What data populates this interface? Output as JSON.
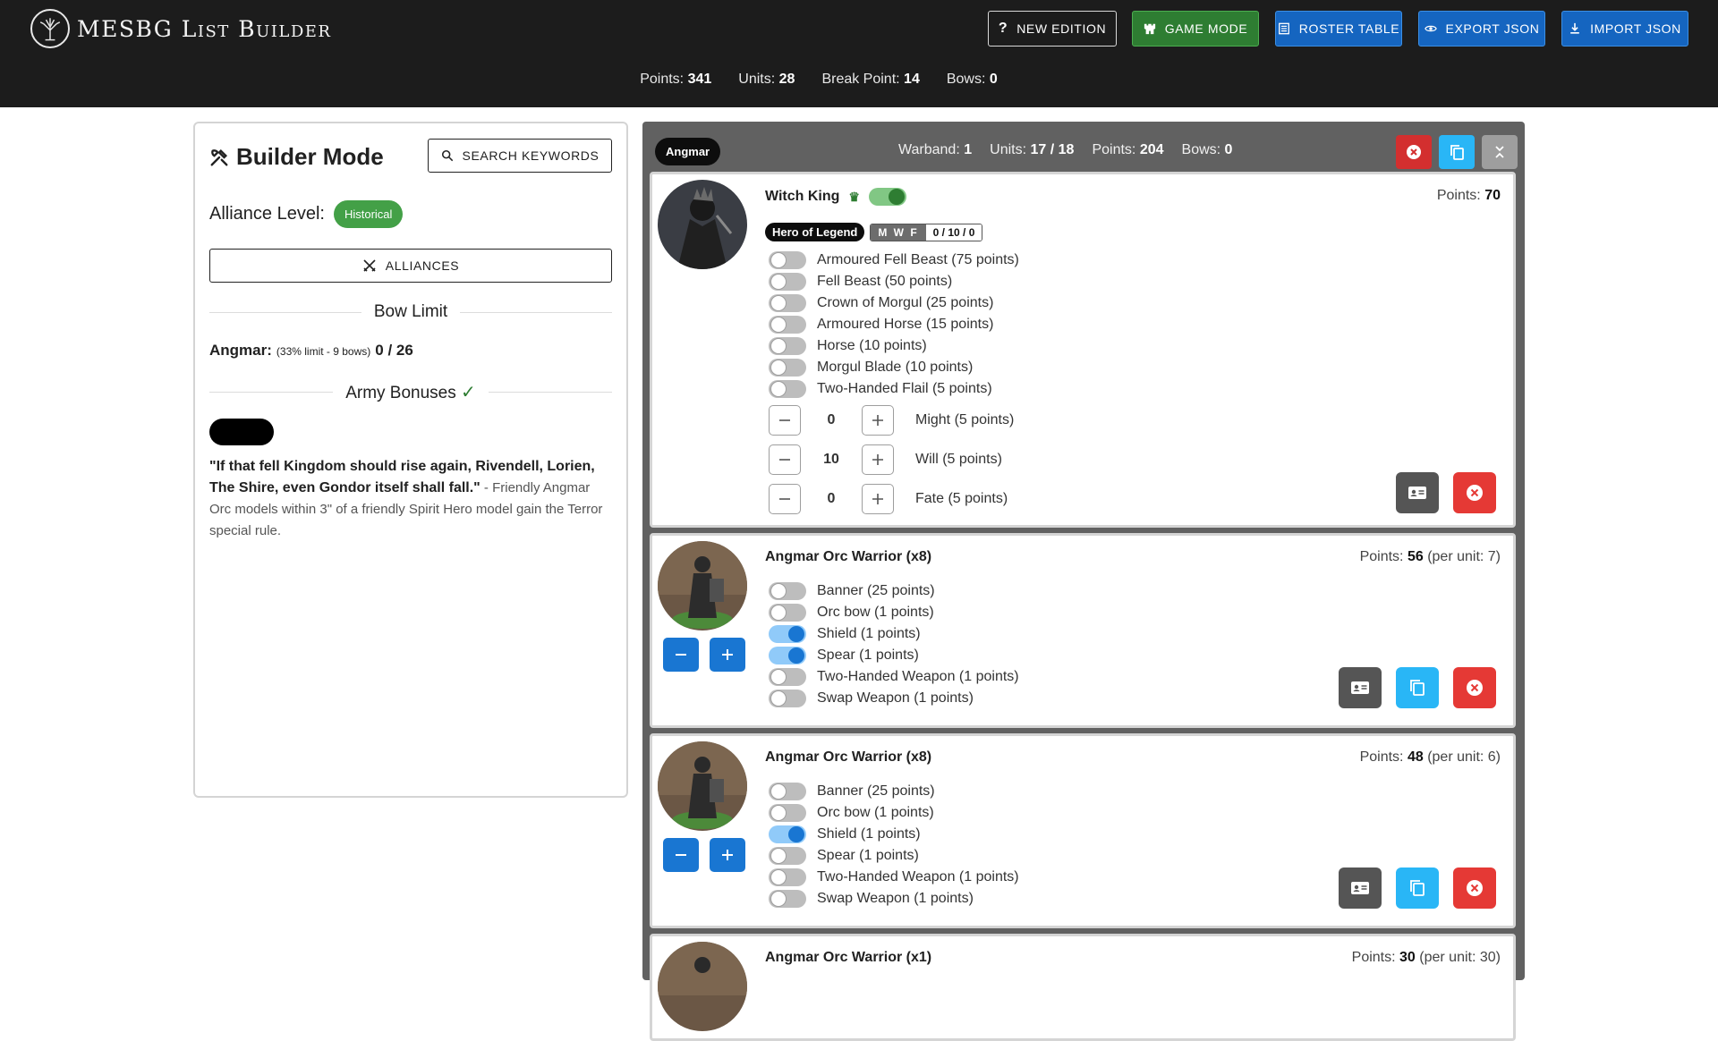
{
  "app": {
    "title": "MESBG List Builder"
  },
  "toolbar": {
    "new_edition": "New Edition",
    "game_mode": "Game Mode",
    "roster_table": "Roster Table",
    "export_json": "Export JSON",
    "import_json": "Import JSON"
  },
  "summary": {
    "points_label": "Points:",
    "points": "341",
    "units_label": "Units:",
    "units": "28",
    "break_label": "Break Point:",
    "break_point": "14",
    "bows_label": "Bows:",
    "bows": "0"
  },
  "builder": {
    "title": "Builder Mode",
    "search_label": "Search Keywords",
    "alliance_label": "Alliance Level:",
    "alliance_value": "Historical",
    "alliances_button": "Alliances",
    "bow_limit_title": "Bow Limit",
    "bow_faction": "Angmar:",
    "bow_detail": "(33% limit - 9 bows)",
    "bow_value": "0 / 26",
    "army_bonuses_title": "Army Bonuses",
    "bonus_quote": "\"If that fell Kingdom should rise again, Rivendell, Lorien, The Shire, even Gondor itself shall fall.\"",
    "bonus_desc": " - Friendly Angmar Orc models within 3\" of a friendly Spirit Hero model gain the Terror special rule."
  },
  "warband": {
    "faction": "Angmar",
    "warband_label": "Warband:",
    "warband": "1",
    "units_label": "Units:",
    "units": "17 / 18",
    "points_label": "Points:",
    "points": "204",
    "bows_label": "Bows:",
    "bows": "0"
  },
  "units": [
    {
      "name": "Witch King",
      "points_label": "Points:",
      "points": "70",
      "leader_toggle": true,
      "role_tag": "Hero of Legend",
      "mwf_label": "M W F",
      "mwf_value": "0 / 10 / 0",
      "options": [
        {
          "label": "Armoured Fell Beast (75 points)",
          "on": false
        },
        {
          "label": "Fell Beast (50 points)",
          "on": false
        },
        {
          "label": "Crown of Morgul (25 points)",
          "on": false
        },
        {
          "label": "Armoured Horse (15 points)",
          "on": false
        },
        {
          "label": "Horse (10 points)",
          "on": false
        },
        {
          "label": "Morgul Blade (10 points)",
          "on": false
        },
        {
          "label": "Two-Handed Flail (5 points)",
          "on": false
        }
      ],
      "stats": [
        {
          "value": "0",
          "label": "Might (5 points)"
        },
        {
          "value": "10",
          "label": "Will (5 points)"
        },
        {
          "value": "0",
          "label": "Fate (5 points)"
        }
      ]
    },
    {
      "name": "Angmar Orc Warrior (x8)",
      "points_label": "Points:",
      "points": "56",
      "per_unit": "(per unit: 7)",
      "options": [
        {
          "label": "Banner (25 points)",
          "on": false
        },
        {
          "label": "Orc bow (1 points)",
          "on": false
        },
        {
          "label": "Shield (1 points)",
          "on": true
        },
        {
          "label": "Spear (1 points)",
          "on": true
        },
        {
          "label": "Two-Handed Weapon (1 points)",
          "on": false
        },
        {
          "label": "Swap Weapon (1 points)",
          "on": false
        }
      ]
    },
    {
      "name": "Angmar Orc Warrior (x8)",
      "points_label": "Points:",
      "points": "48",
      "per_unit": "(per unit: 6)",
      "options": [
        {
          "label": "Banner (25 points)",
          "on": false
        },
        {
          "label": "Orc bow (1 points)",
          "on": false
        },
        {
          "label": "Shield (1 points)",
          "on": true
        },
        {
          "label": "Spear (1 points)",
          "on": false
        },
        {
          "label": "Two-Handed Weapon (1 points)",
          "on": false
        },
        {
          "label": "Swap Weapon (1 points)",
          "on": false
        }
      ]
    },
    {
      "name": "Angmar Orc Warrior (x1)",
      "points_label": "Points:",
      "points": "30",
      "per_unit": "(per unit: 30)"
    }
  ],
  "colors": {
    "appbar": "#1c1c1c",
    "game_mode": "#2e7d32",
    "primary": "#1565c0",
    "alliance_chip": "#43a047",
    "warband_bg": "#616161",
    "delete": "#e53935",
    "copy": "#29b6f6"
  },
  "icons": {
    "logo": "tree-emblem-icon",
    "new_edition": "question-icon",
    "game_mode": "castle-icon",
    "roster_table": "table-icon",
    "export_json": "eye-icon",
    "import_json": "download-icon",
    "builder": "hammer-wrench-icon",
    "search": "search-icon",
    "alliances": "crossed-swords-icon",
    "leader": "crown-icon"
  }
}
